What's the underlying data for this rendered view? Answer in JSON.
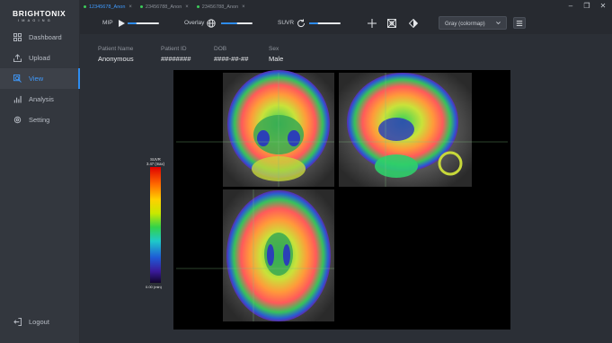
{
  "brand": {
    "name": "BRIGHTONIX",
    "sub": "IMAGING"
  },
  "sidebar": {
    "items": [
      {
        "label": "Dashboard",
        "icon": "grid-icon"
      },
      {
        "label": "Upload",
        "icon": "upload-icon"
      },
      {
        "label": "View",
        "icon": "view-icon",
        "active": true
      },
      {
        "label": "Analysis",
        "icon": "bar-chart-icon"
      },
      {
        "label": "Setting",
        "icon": "gear-icon"
      }
    ],
    "logout": "Logout"
  },
  "tabs": [
    {
      "label": "12345678_Anon",
      "active": true
    },
    {
      "label": "23456788_Anon",
      "active": false
    },
    {
      "label": "23456788_Anon",
      "active": false
    }
  ],
  "toolbar": {
    "mip_label": "MIP",
    "overlay_label": "Overlay",
    "suvr_label": "SUVR",
    "colormap_value": "Gray (colormap)"
  },
  "patient": {
    "name_label": "Patient Name",
    "name": "Anonymous",
    "id_label": "Patient ID",
    "id": "########",
    "dob_label": "DOB",
    "dob": "####-##-##",
    "sex_label": "Sex",
    "sex": "Male"
  },
  "colorbar": {
    "title": "SUVR",
    "max_label": "3.47 (max)",
    "min_label": "0.00 (min)"
  },
  "colors": {
    "accent": "#2d8cf0",
    "active_text": "#3f9bff",
    "sidebar_bg": "#33373e",
    "main_bg": "#2b2f36",
    "tab_dot": "#3ccb5a"
  }
}
